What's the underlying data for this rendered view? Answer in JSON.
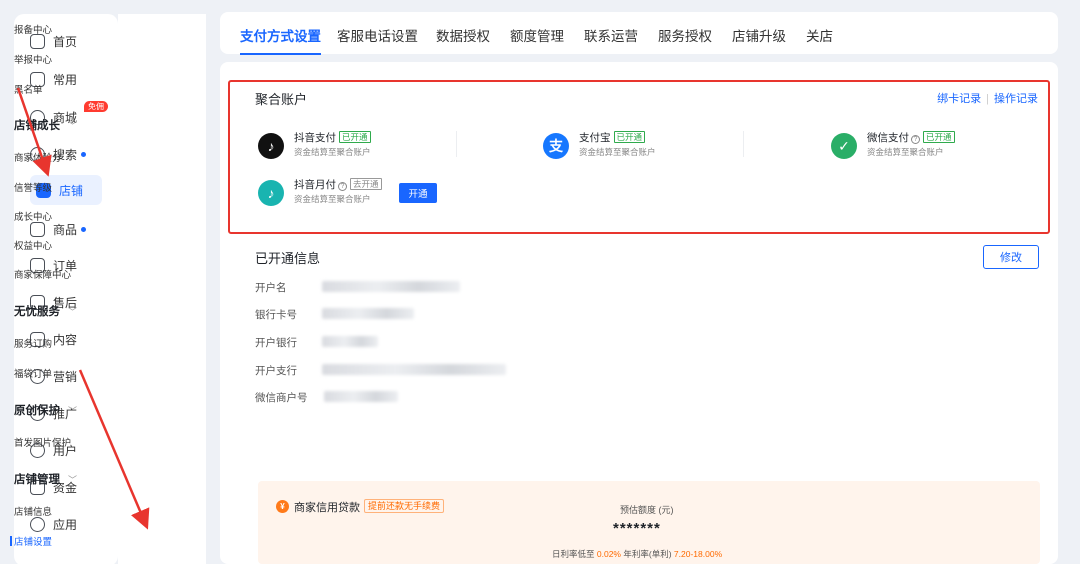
{
  "nav_primary": [
    {
      "label": "首页",
      "icon": "home-icon"
    },
    {
      "label": "常用",
      "icon": "folder-icon"
    },
    {
      "label": "商城",
      "icon": "shop-icon",
      "badge": "免佣"
    },
    {
      "label": "搜索",
      "icon": "search-icon",
      "dot": true
    },
    {
      "label": "店铺",
      "icon": "store-icon",
      "active": true
    },
    {
      "label": "商品",
      "icon": "goods-icon",
      "dot": true
    },
    {
      "label": "订单",
      "icon": "order-icon"
    },
    {
      "label": "售后",
      "icon": "after-sales-icon"
    },
    {
      "label": "内容",
      "icon": "content-icon"
    },
    {
      "label": "营销",
      "icon": "marketing-icon"
    },
    {
      "label": "推广",
      "icon": "promotion-icon"
    },
    {
      "label": "用户",
      "icon": "user-icon"
    },
    {
      "label": "资金",
      "icon": "wallet-icon"
    },
    {
      "label": "应用",
      "icon": "app-icon"
    }
  ],
  "nav_secondary": {
    "top_items": [
      "报备中心",
      "举报中心",
      "黑名单"
    ],
    "groups": [
      {
        "title": "店铺成长",
        "items": [
          "商家体验分",
          "信誉等级",
          "成长中心",
          "权益中心",
          "商家保障中心"
        ]
      },
      {
        "title": "无忧服务",
        "items": [
          "服务订购",
          "福袋订单"
        ]
      },
      {
        "title": "原创保护",
        "items": [
          "首发图片保护"
        ]
      },
      {
        "title": "店铺管理",
        "items": [
          "店铺信息",
          "店铺设置"
        ]
      }
    ],
    "active_item": "店铺设置"
  },
  "tabs": [
    "支付方式设置",
    "客服电话设置",
    "数据授权",
    "额度管理",
    "联系运营",
    "服务授权",
    "店铺升级",
    "关店"
  ],
  "aggregate": {
    "title": "聚合账户",
    "links": [
      "绑卡记录",
      "操作记录"
    ],
    "methods": [
      {
        "name": "抖音支付",
        "status": "已开通",
        "desc": "资金结算至聚合账户",
        "color": "#111111"
      },
      {
        "name": "支付宝",
        "status": "已开通",
        "desc": "资金结算至聚合账户",
        "color": "#1677ff"
      },
      {
        "name": "微信支付",
        "status": "已开通",
        "desc": "资金结算至聚合账户",
        "color": "#2aae67",
        "help": "?"
      },
      {
        "name": "抖音月付",
        "status": "去开通",
        "desc": "资金结算至聚合账户",
        "color": "#19b4b0",
        "help": "?"
      }
    ],
    "open_button": "开通"
  },
  "opened_info": {
    "title": "已开通信息",
    "edit_button": "修改",
    "fields": [
      {
        "label": "开户名"
      },
      {
        "label": "银行卡号"
      },
      {
        "label": "开户银行"
      },
      {
        "label": "开户支行"
      },
      {
        "label": "微信商户号"
      }
    ]
  },
  "loan": {
    "icon_text": "¥",
    "name": "商家信用贷款",
    "tag": "提前还款无手续费",
    "estimate_label": "预估额度 (元)",
    "amount": "*******",
    "rate_prefix": "日利率低至",
    "daily_rate": "0.02%",
    "rate_mid": "年利率(单利)",
    "annual_rate": "7.20-18.00%"
  },
  "colors": {
    "accent": "#1966ff",
    "highlight": "#e8352e"
  }
}
